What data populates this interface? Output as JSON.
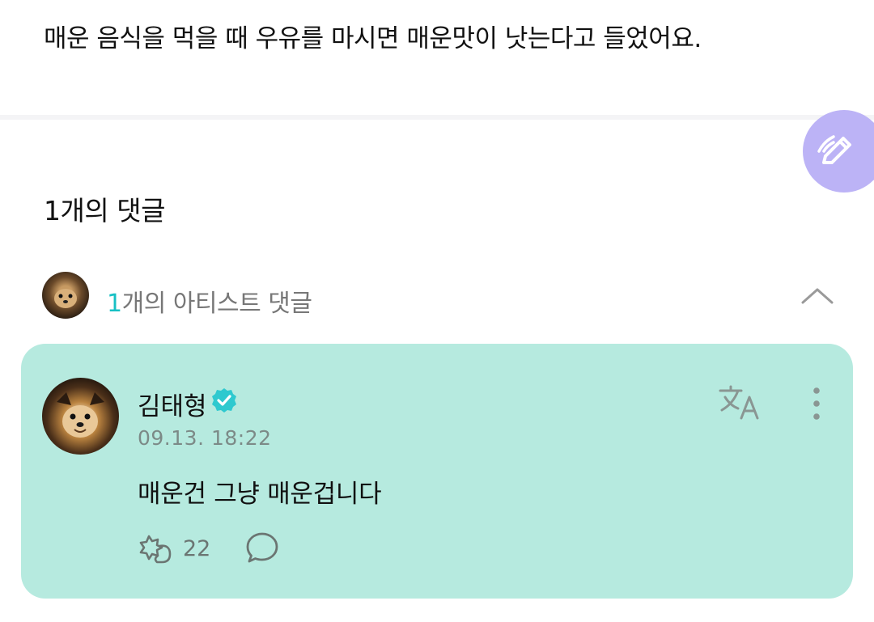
{
  "post": {
    "body": "매운 음식을 먹을 때 우유를 마시면 매운맛이 낫는다고 들었어요."
  },
  "comments": {
    "count_label": "1개의 댓글",
    "artist_count": "1",
    "artist_label": "개의 아티스트 댓글"
  },
  "comment": {
    "author": "김태형",
    "timestamp": "09.13. 18:22",
    "text": "매운건 그냥 매운겁니다",
    "like_count": "22"
  },
  "icons": {
    "fab": "pencil-icon",
    "collapse": "chevron-up-icon",
    "verified": "verified-badge-icon",
    "translate": "translate-icon",
    "more": "more-vertical-icon",
    "like": "cheer-icon",
    "reply": "speech-bubble-icon"
  },
  "colors": {
    "card_background": "#b6eadf",
    "fab_background": "#bcb3f6",
    "accent": "#17c0c4"
  }
}
